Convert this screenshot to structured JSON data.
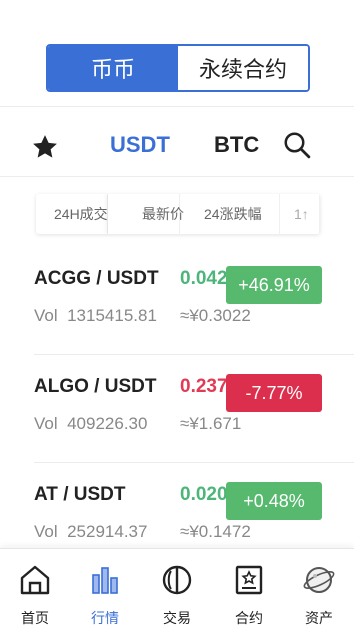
{
  "segment": {
    "spot": "币币",
    "contract": "永续合约"
  },
  "quote_tabs": {
    "usdt": "USDT",
    "btc": "BTC"
  },
  "sort_bar": {
    "volume": "24H成交",
    "latest": "最新价",
    "change": "24涨跌幅",
    "more": "1↑"
  },
  "rows": [
    {
      "pair": "ACGG / USDT",
      "vol_label": "Vol",
      "vol": "1315415.81",
      "price": "0.0420",
      "cny": "≈¥0.3022",
      "change": "+46.91%",
      "direction": "up"
    },
    {
      "pair": "ALGO / USDT",
      "vol_label": "Vol",
      "vol": "409226.30",
      "price": "0.2373",
      "cny": "≈¥1.671",
      "change": "-7.77%",
      "direction": "down"
    },
    {
      "pair": "AT / USDT",
      "vol_label": "Vol",
      "vol": "252914.37",
      "price": "0.0200",
      "cny": "≈¥0.1472",
      "change": "+0.48%",
      "direction": "up"
    }
  ],
  "nav": [
    {
      "label": "首页",
      "icon": "home-icon",
      "active": false
    },
    {
      "label": "行情",
      "icon": "bar-chart-icon",
      "active": true
    },
    {
      "label": "交易",
      "icon": "trade-icon",
      "active": false
    },
    {
      "label": "合约",
      "icon": "contract-icon",
      "active": false
    },
    {
      "label": "资产",
      "icon": "planet-icon",
      "active": false
    }
  ],
  "colors": {
    "accent": "#3a6fd6",
    "up": "#57b96e",
    "down": "#dc2f4e"
  }
}
